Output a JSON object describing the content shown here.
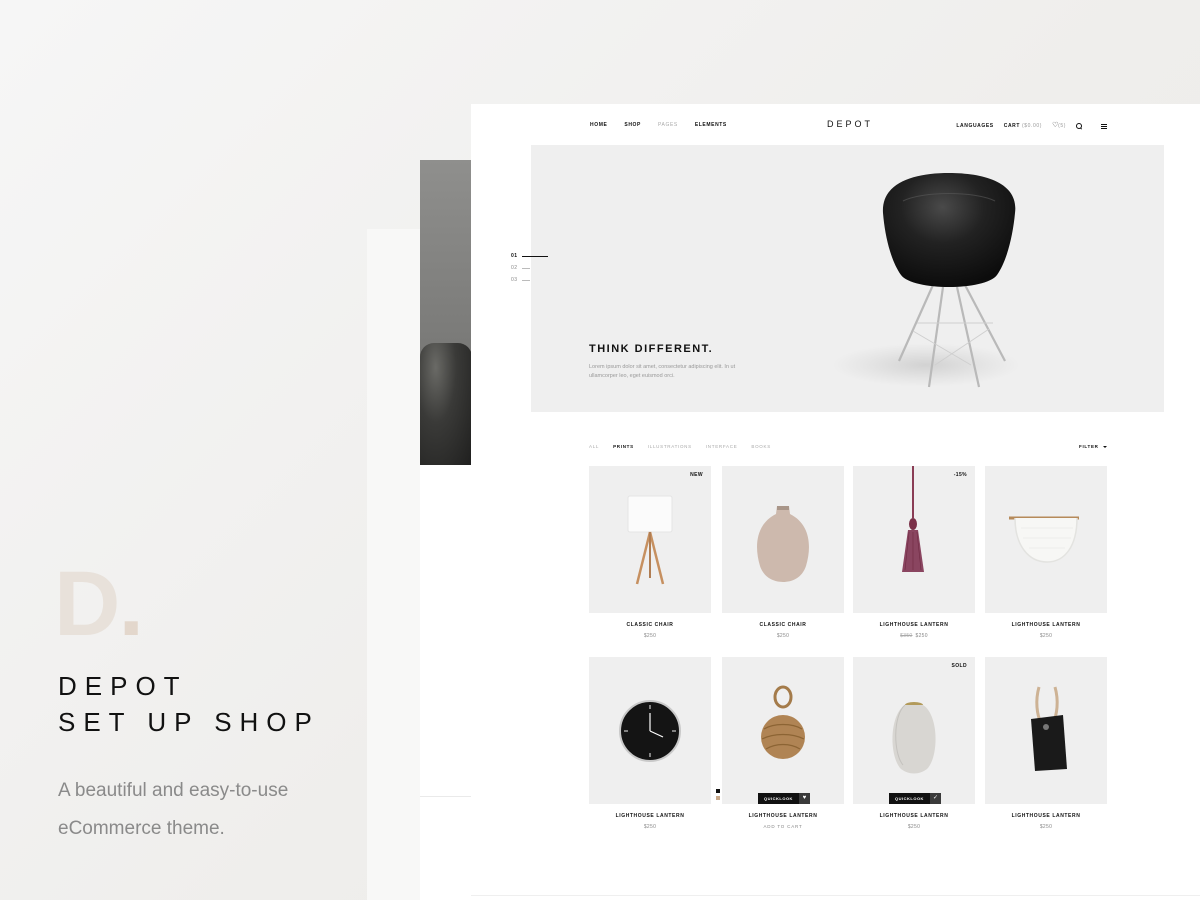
{
  "promo": {
    "mark": "D",
    "mark_dot": ".",
    "title_line1": "DEPOT",
    "title_line2": "SET UP SHOP",
    "tagline": "A beautiful and easy-to-use eCommerce theme."
  },
  "nav": {
    "links": [
      "HOME",
      "SHOP",
      "PAGES",
      "ELEMENTS"
    ],
    "brand": "DEPOT",
    "languages": "LANGUAGES",
    "cart_label": "CART",
    "cart_total": "($0.00)",
    "wishlist_count": "(5)"
  },
  "hero": {
    "slides": [
      "01",
      "02",
      "03"
    ],
    "title": "THINK DIFFERENT.",
    "text": "Lorem ipsum dolor sit amet, consectetur adipiscing elit. In ut ullamcorper leo, eget euismod orci."
  },
  "filters": {
    "tabs": [
      "ALL",
      "PRINTS",
      "ILLUSTRATIONS",
      "INTERFACE",
      "BOOKS"
    ],
    "active": "PRINTS",
    "filter_label": "FILTER"
  },
  "products": [
    {
      "name": "CLASSIC CHAIR",
      "price": "$250",
      "badge": "NEW"
    },
    {
      "name": "CLASSIC CHAIR",
      "price": "$250",
      "badge": ""
    },
    {
      "name": "LIGHTHOUSE LANTERN",
      "old_price": "$350",
      "price": "$250",
      "badge": "-15%"
    },
    {
      "name": "LIGHTHOUSE LANTERN",
      "price": "$250",
      "badge": ""
    },
    {
      "name": "LIGHTHOUSE LANTERN",
      "price": "$250",
      "badge": ""
    },
    {
      "name": "LIGHTHOUSE LANTERN",
      "price": "ADD TO CART",
      "badge": "",
      "quicklook": "QUICKLOOK"
    },
    {
      "name": "LIGHTHOUSE LANTERN",
      "price": "$250",
      "badge": "SOLD",
      "quicklook": "QUICKLOOK"
    },
    {
      "name": "LIGHTHOUSE LANTERN",
      "price": "$250",
      "badge": ""
    }
  ],
  "colors": {
    "accent": "#111111",
    "background": "#f3f3f2",
    "thumb_bg": "#efefef",
    "muted_text": "#8a8a8a"
  },
  "icons": [
    "heart-icon",
    "search-icon",
    "menu-icon",
    "caret-down-icon",
    "check-icon"
  ]
}
